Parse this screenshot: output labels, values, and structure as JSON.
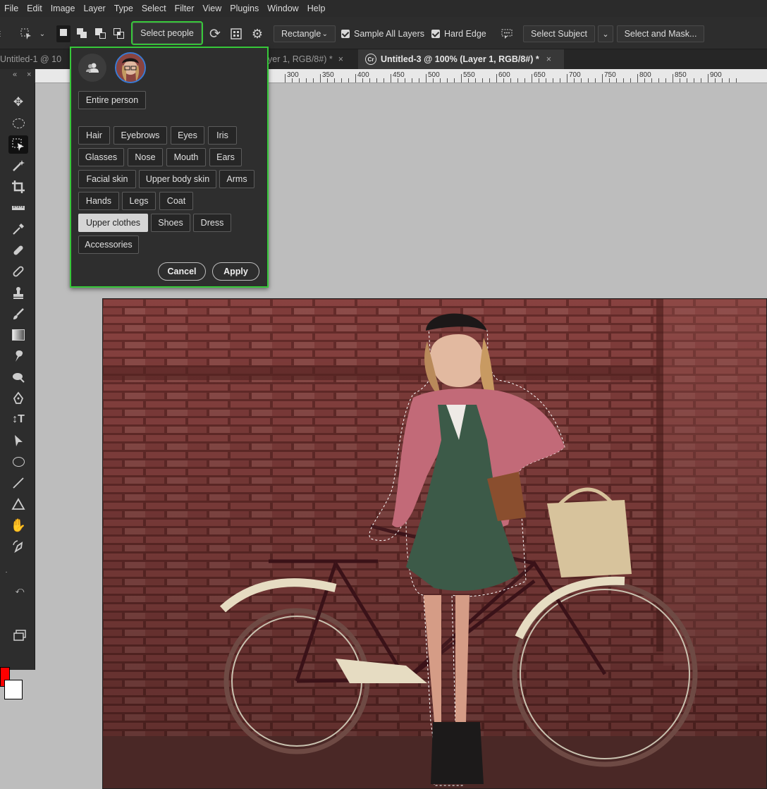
{
  "menu": [
    "File",
    "Edit",
    "Image",
    "Layer",
    "Type",
    "Select",
    "Filter",
    "View",
    "Plugins",
    "Window",
    "Help"
  ],
  "options": {
    "select_people": "Select people",
    "shape_mode": "Rectangle",
    "sample_all_layers": "Sample All Layers",
    "hard_edge": "Hard Edge",
    "select_subject": "Select Subject",
    "select_and_mask": "Select and Mask..."
  },
  "tabs": {
    "tab1": "Untitled-1 @ 10",
    "tab2": "yer 1, RGB/8#) *",
    "tab3": "Untitled-3 @ 100% (Layer 1, RGB/8#) *",
    "close": "×"
  },
  "ruler": [
    "300",
    "350",
    "400",
    "450",
    "500",
    "550",
    "600",
    "650",
    "700",
    "750",
    "800",
    "850",
    "900"
  ],
  "people_panel": {
    "entire_person": "Entire person",
    "parts": [
      [
        "Hair",
        "Eyebrows",
        "Eyes",
        "Iris"
      ],
      [
        "Glasses",
        "Nose",
        "Mouth",
        "Ears"
      ],
      [
        "Facial skin",
        "Upper body skin",
        "Arms"
      ],
      [
        "Hands",
        "Legs",
        "Coat"
      ],
      [
        "Upper clothes",
        "Shoes",
        "Dress"
      ],
      [
        "Accessories"
      ]
    ],
    "selected_part": "Upper clothes",
    "cancel": "Cancel",
    "apply": "Apply"
  },
  "colors": {
    "foreground": "#ff0000",
    "background": "#ffffff",
    "highlight": "#37c83a"
  }
}
